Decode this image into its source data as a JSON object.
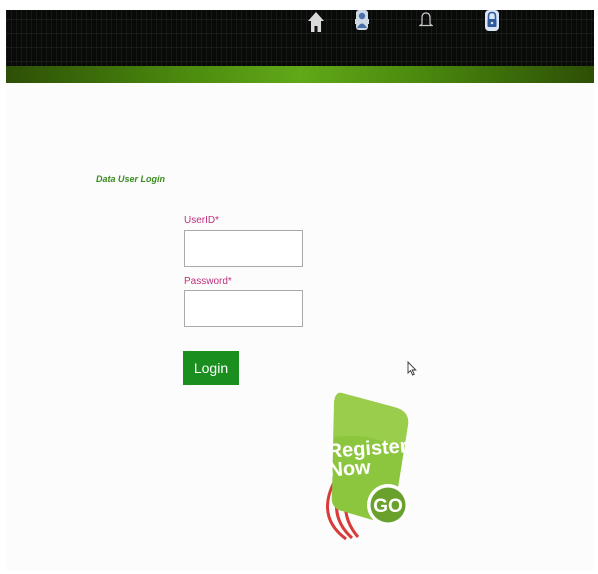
{
  "nav": {
    "icons": [
      "home-icon",
      "user-icon",
      "bell-icon",
      "lock-icon"
    ]
  },
  "login": {
    "title": "Data User Login",
    "userid_label": "UserID*",
    "userid_value": "",
    "password_label": "Password*",
    "password_value": "",
    "submit_label": "Login"
  },
  "register": {
    "line1": "Register",
    "line2": "Now",
    "go": "GO"
  },
  "colors": {
    "accent_green": "#1a8f1f",
    "label_pink": "#c0307f",
    "title_green": "#3a8c1e",
    "badge_green": "#8cc63f"
  }
}
